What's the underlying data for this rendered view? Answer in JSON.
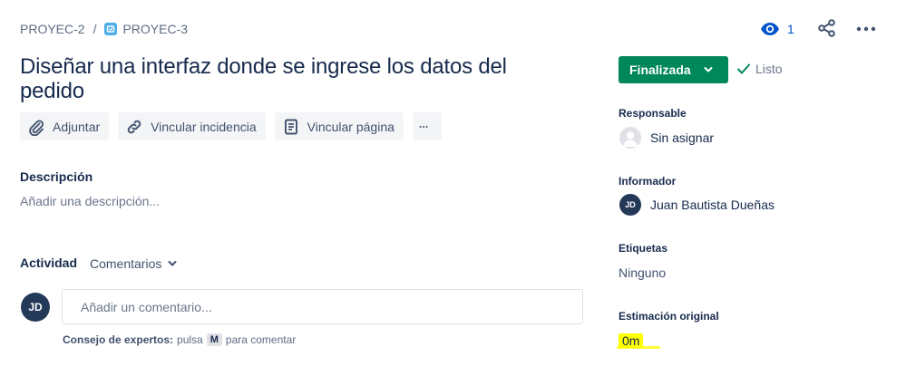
{
  "breadcrumb": {
    "parent": "PROYEC-2",
    "separator": "/",
    "current": "PROYEC-3"
  },
  "header": {
    "watch_count": "1",
    "icons": [
      "eye-icon",
      "share-icon",
      "more-icon"
    ]
  },
  "issue": {
    "title": "Diseñar una interfaz donde se ingrese los datos del pedido"
  },
  "actions": {
    "attach": "Adjuntar",
    "link_issue": "Vincular incidencia",
    "link_page": "Vincular página"
  },
  "description": {
    "label": "Descripción",
    "placeholder": "Añadir una descripción..."
  },
  "activity": {
    "label": "Actividad",
    "filter": "Comentarios",
    "avatar_initials": "JD",
    "comment_placeholder": "Añadir un comentario...",
    "tip_bold": "Consejo de expertos:",
    "tip_press": "pulsa",
    "tip_key": "M",
    "tip_rest": "para comentar"
  },
  "sidebar": {
    "status": "Finalizada",
    "resolution": "Listo",
    "assignee_label": "Responsable",
    "assignee_value": "Sin asignar",
    "reporter_label": "Informador",
    "reporter_initials": "JD",
    "reporter_value": "Juan Bautista Dueñas",
    "labels_label": "Etiquetas",
    "labels_value": "Ninguno",
    "estimate_label": "Estimación original",
    "estimate_value": "0m"
  },
  "colors": {
    "status_green": "#00875a",
    "link_blue": "#0052cc",
    "highlight": "#ffff00",
    "avatar_navy": "#243858"
  }
}
